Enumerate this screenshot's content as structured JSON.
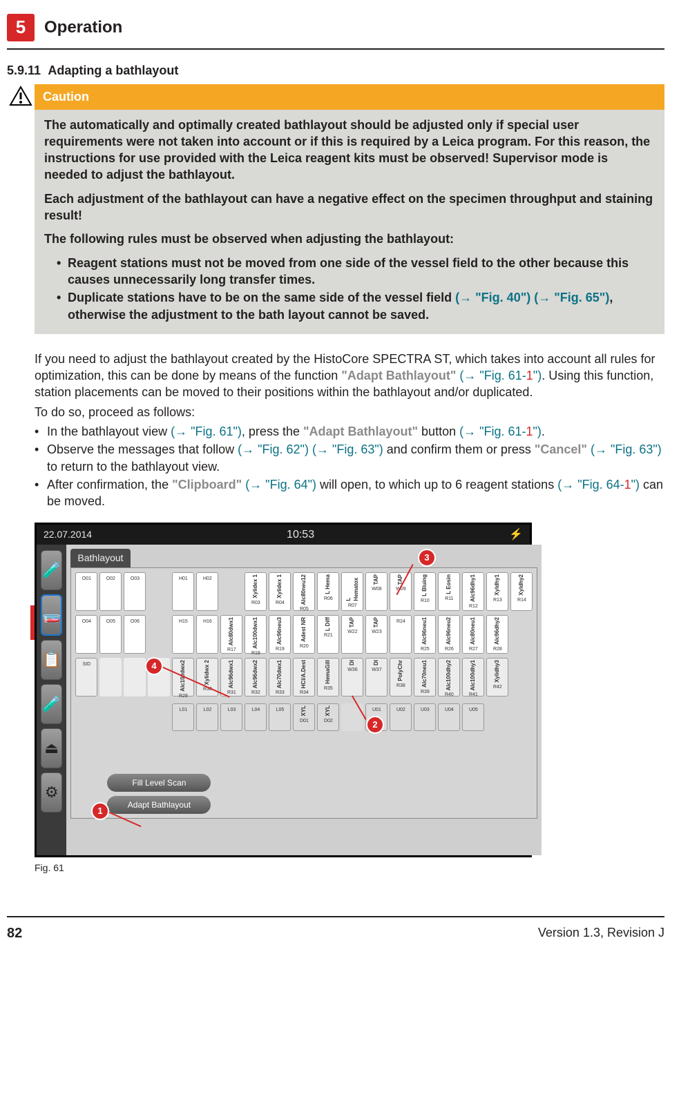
{
  "header": {
    "chapter_number": "5",
    "chapter_title": "Operation"
  },
  "section": {
    "number": "5.9.11",
    "title": "Adapting a bathlayout"
  },
  "caution": {
    "label": "Caution",
    "p1": "The automatically and optimally created bathlayout should be adjusted only if special user requirements were not taken into account or if this is required by a Leica program. For this reason, the instructions for use provided with the Leica reagent kits must be observed! Supervisor mode is needed to adjust the bathlayout.",
    "p2": "Each adjustment of the bathlayout can have a negative effect on the specimen throughput and staining result!",
    "p3": "The following rules must be observed when adjusting the bathlayout:",
    "bullet1": "Reagent stations must not be moved from one side of the vessel field to the other because this causes unnecessarily long transfer times.",
    "bullet2a": "Duplicate stations have to be on the same side of the vessel field ",
    "bullet2_link1": "(→ \"Fig. 40\")",
    "bullet2_link2": "(→ \"Fig. 65\")",
    "bullet2b": ", otherwise the adjustment to the bath layout cannot be saved."
  },
  "body": {
    "p1a": "If you need to adjust the bathlayout created by the HistoCore SPECTRA ST, which takes into account all rules for optimization, this can be done by means of the function ",
    "p1_bold": "\"Adapt Bathlayout\"",
    "p1_link": "(→ \"Fig. 61-",
    "p1_red": "1",
    "p1_link_end": "\")",
    "p1b": ". Using this function, station placements can be moved to their positions within the bathlayout and/or duplicated.",
    "p2": "To do so, proceed as follows:",
    "li1a": "In the bathlayout view ",
    "li1_link1": "(→ \"Fig. 61\")",
    "li1_mid": ", press the ",
    "li1_bold": "\"Adapt Bathlayout\"",
    "li1b": " button ",
    "li1_link2": "(→ \"Fig. 61-",
    "li1_red": "1",
    "li1_link2_end": "\")",
    "li1_end": ".",
    "li2a": "Observe the messages that follow ",
    "li2_link1": "(→ \"Fig. 62\")",
    "li2_link2": "(→ \"Fig. 63\")",
    "li2b": " and confirm them or press ",
    "li2_bold": "\"Cancel\"",
    "li2_link3": "(→ \"Fig. 63\")",
    "li2c": " to return to the bathlayout view.",
    "li3a": "After confirmation, the ",
    "li3_bold": "\"Clipboard\"",
    "li3_link1": "(→ \"Fig. 64\")",
    "li3b": " will open, to which up to 6 reagent stations ",
    "li3_link2": "(→ \"Fig. 64-",
    "li3_red": "1",
    "li3_link2_end": "\")",
    "li3c": " can be moved."
  },
  "figure": {
    "date": "22.07.2014",
    "time": "10:53",
    "tab": "Bathlayout",
    "btn_fill": "Fill Level Scan",
    "btn_adapt": "Adapt Bathlayout",
    "caption": "Fig. 61",
    "callouts": {
      "c1": "1",
      "c2": "2",
      "c3": "3",
      "c4": "4"
    },
    "row1": [
      {
        "id": "O01",
        "lbl": ""
      },
      {
        "id": "O02",
        "lbl": ""
      },
      {
        "id": "O03",
        "lbl": ""
      },
      {
        "id": "",
        "lbl": "",
        "gap": true
      },
      {
        "id": "H01",
        "lbl": ""
      },
      {
        "id": "H02",
        "lbl": ""
      },
      {
        "id": "",
        "lbl": "",
        "gap": true
      },
      {
        "id": "R03",
        "lbl": "Xylidex 1"
      },
      {
        "id": "R04",
        "lbl": "Xylidex 1"
      },
      {
        "id": "R05",
        "lbl": "Alc80neu12"
      },
      {
        "id": "R06",
        "lbl": "L Hema"
      },
      {
        "id": "R07",
        "lbl": "L Hematox"
      },
      {
        "id": "W08",
        "lbl": "TAP"
      },
      {
        "id": "W09",
        "lbl": "TAP"
      },
      {
        "id": "R10",
        "lbl": "L Bluing"
      },
      {
        "id": "R11",
        "lbl": "L Eosin"
      },
      {
        "id": "R12",
        "lbl": "Alc96dhy1"
      },
      {
        "id": "R13",
        "lbl": "Xyldhy1"
      },
      {
        "id": "R14",
        "lbl": "Xyldhy2"
      }
    ],
    "row2": [
      {
        "id": "O04",
        "lbl": ""
      },
      {
        "id": "O05",
        "lbl": ""
      },
      {
        "id": "O06",
        "lbl": ""
      },
      {
        "id": "",
        "lbl": "",
        "gap": true
      },
      {
        "id": "H15",
        "lbl": ""
      },
      {
        "id": "H16",
        "lbl": ""
      },
      {
        "id": "R17",
        "lbl": "Alc80dwx1"
      },
      {
        "id": "R18",
        "lbl": "Alc100dwx1"
      },
      {
        "id": "R19",
        "lbl": "Alc96neu3"
      },
      {
        "id": "R20",
        "lbl": "Adest NR"
      },
      {
        "id": "R21",
        "lbl": "L Diff"
      },
      {
        "id": "W22",
        "lbl": "TAP"
      },
      {
        "id": "W23",
        "lbl": "TAP"
      },
      {
        "id": "R24",
        "lbl": ""
      },
      {
        "id": "R25",
        "lbl": "Alc96neu1"
      },
      {
        "id": "R26",
        "lbl": "Alc96neu2"
      },
      {
        "id": "R27",
        "lbl": "Alc80neu1"
      },
      {
        "id": "R28",
        "lbl": "Alc96dhy2"
      }
    ],
    "row3": [
      {
        "id": "SID",
        "lbl": ""
      },
      {
        "id": "",
        "lbl": "",
        "gap": true
      },
      {
        "id": "",
        "lbl": "",
        "gap": true
      },
      {
        "id": "",
        "lbl": "",
        "gap": true
      },
      {
        "id": "R29",
        "lbl": "Alc100dwx2"
      },
      {
        "id": "R30",
        "lbl": "Xylidwx 2"
      },
      {
        "id": "R31",
        "lbl": "Alc96dwx1"
      },
      {
        "id": "R32",
        "lbl": "Alc96dwx2"
      },
      {
        "id": "R33",
        "lbl": "Alc70dwx1"
      },
      {
        "id": "R34",
        "lbl": "HCl/A.Dest"
      },
      {
        "id": "R35",
        "lbl": "HemaGill"
      },
      {
        "id": "W36",
        "lbl": "DI"
      },
      {
        "id": "W37",
        "lbl": "DI"
      },
      {
        "id": "R38",
        "lbl": "PolyChr"
      },
      {
        "id": "R39",
        "lbl": "Alc70neu1"
      },
      {
        "id": "R40",
        "lbl": "Alc100dhy2"
      },
      {
        "id": "R41",
        "lbl": "Alc100dhy1"
      },
      {
        "id": "R42",
        "lbl": "Xylidhy3"
      }
    ],
    "row4": [
      {
        "id": "L01",
        "lbl": ""
      },
      {
        "id": "L02",
        "lbl": ""
      },
      {
        "id": "L03",
        "lbl": ""
      },
      {
        "id": "L04",
        "lbl": ""
      },
      {
        "id": "L05",
        "lbl": ""
      },
      {
        "id": "D01",
        "lbl": "XYL"
      },
      {
        "id": "D02",
        "lbl": "XYL"
      },
      {
        "id": "",
        "lbl": "",
        "gap": true
      },
      {
        "id": "U01",
        "lbl": ""
      },
      {
        "id": "U02",
        "lbl": ""
      },
      {
        "id": "U03",
        "lbl": ""
      },
      {
        "id": "U04",
        "lbl": ""
      },
      {
        "id": "U05",
        "lbl": ""
      }
    ]
  },
  "footer": {
    "page": "82",
    "version": "Version 1.3, Revision J"
  }
}
